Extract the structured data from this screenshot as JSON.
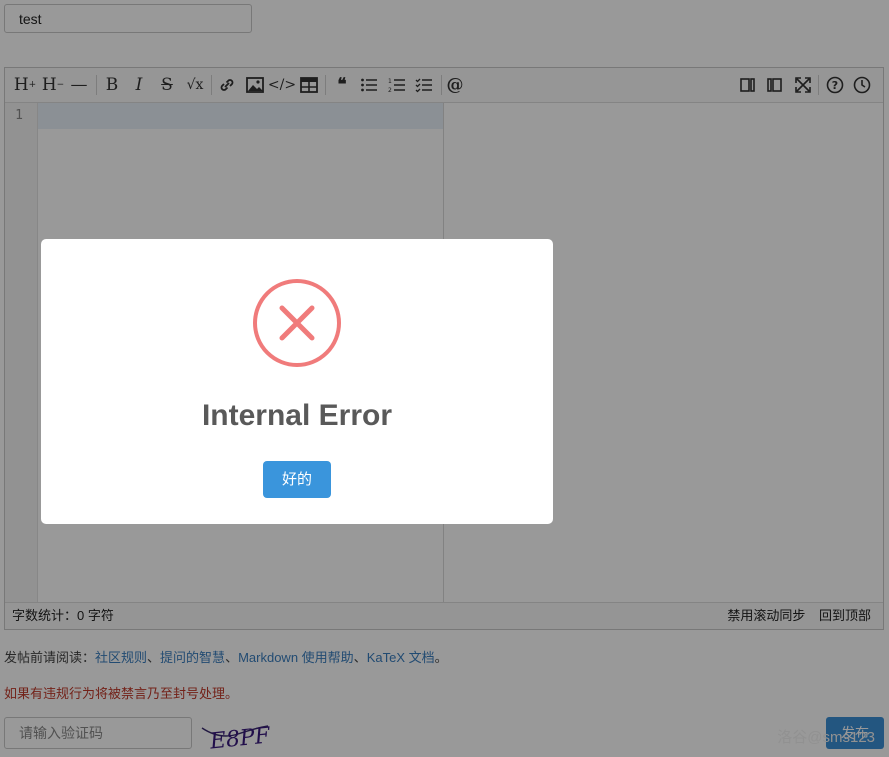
{
  "title_input": {
    "value": "test"
  },
  "toolbar": {
    "buttons": [
      {
        "name": "heading-increase-icon",
        "glyph": "H"
      },
      {
        "name": "heading-decrease-icon",
        "glyph": "H"
      },
      {
        "name": "horizontal-rule-icon",
        "glyph": "—"
      },
      {
        "name": "bold-icon",
        "glyph": "B"
      },
      {
        "name": "italic-icon",
        "glyph": "I"
      },
      {
        "name": "strikethrough-icon",
        "glyph": "S"
      },
      {
        "name": "math-icon",
        "glyph": "√x"
      },
      {
        "name": "link-icon",
        "glyph": "🔗"
      },
      {
        "name": "image-icon",
        "glyph": "▣"
      },
      {
        "name": "code-icon",
        "glyph": "</>"
      },
      {
        "name": "table-icon",
        "glyph": "▦"
      },
      {
        "name": "quote-icon",
        "glyph": "❝"
      },
      {
        "name": "bullet-list-icon",
        "glyph": "☰"
      },
      {
        "name": "numbered-list-icon",
        "glyph": "☰"
      },
      {
        "name": "checklist-icon",
        "glyph": "☰"
      },
      {
        "name": "mention-icon",
        "glyph": "@"
      },
      {
        "name": "split-view-icon",
        "glyph": "◫"
      },
      {
        "name": "preview-only-icon",
        "glyph": "▯"
      },
      {
        "name": "fullscreen-icon",
        "glyph": "⤢"
      },
      {
        "name": "help-icon",
        "glyph": "?"
      },
      {
        "name": "history-icon",
        "glyph": "◷"
      }
    ]
  },
  "editor": {
    "line_number": "1"
  },
  "statusbar": {
    "count": "字数统计：0 字符",
    "disable_scroll_sync": "禁用滚动同步",
    "back_to_top": "回到顶部"
  },
  "notice": {
    "prefix": "发帖前请阅读：",
    "link1": "社区规则",
    "sep1": "、",
    "link2": "提问的智慧",
    "sep2": "、",
    "link3": "Markdown 使用帮助",
    "sep3": "、",
    "link4": "KaTeX 文档",
    "suffix": "。"
  },
  "warning": "如果有违规行为将被禁言乃至封号处理。",
  "captcha": {
    "placeholder": "请输入验证码",
    "image_text": "E8PF"
  },
  "submit": {
    "label": "发布"
  },
  "watermark": "洛谷@sms123",
  "modal": {
    "title": "Internal Error",
    "ok_label": "好的"
  },
  "colors": {
    "error": "#f07b7b",
    "primary": "#3a95dc"
  }
}
